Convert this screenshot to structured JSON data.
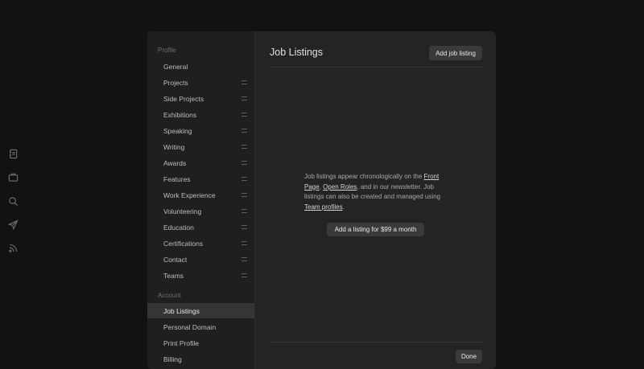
{
  "rail": {
    "icons": [
      "notebook-icon",
      "folder-icon",
      "search-icon",
      "send-icon",
      "rss-icon"
    ]
  },
  "sidebar": {
    "profile_label": "Profile",
    "profile_items": [
      {
        "label": "General",
        "draggable": false
      },
      {
        "label": "Projects",
        "draggable": true
      },
      {
        "label": "Side Projects",
        "draggable": true
      },
      {
        "label": "Exhibitions",
        "draggable": true
      },
      {
        "label": "Speaking",
        "draggable": true
      },
      {
        "label": "Writing",
        "draggable": true
      },
      {
        "label": "Awards",
        "draggable": true
      },
      {
        "label": "Features",
        "draggable": true
      },
      {
        "label": "Work Experience",
        "draggable": true
      },
      {
        "label": "Volunteering",
        "draggable": true
      },
      {
        "label": "Education",
        "draggable": true
      },
      {
        "label": "Certifications",
        "draggable": true
      },
      {
        "label": "Contact",
        "draggable": true
      },
      {
        "label": "Teams",
        "draggable": true
      }
    ],
    "account_label": "Account",
    "account_items": [
      {
        "label": "Job Listings",
        "active": true
      },
      {
        "label": "Personal Domain",
        "active": false
      },
      {
        "label": "Print Profile",
        "active": false
      },
      {
        "label": "Billing",
        "active": false
      }
    ]
  },
  "main": {
    "title": "Job Listings",
    "add_button": "Add job listing",
    "empty": {
      "text1": "Job listings appear chronologically on the ",
      "link1": "Front Page",
      "text2": ", ",
      "link2": "Open Roles",
      "text3": ", and in our newsletter. Job listings can also be created and managed using ",
      "link3": "Team profiles",
      "text4": "."
    },
    "listing_button": "Add a listing for $99 a month",
    "done_button": "Done"
  }
}
